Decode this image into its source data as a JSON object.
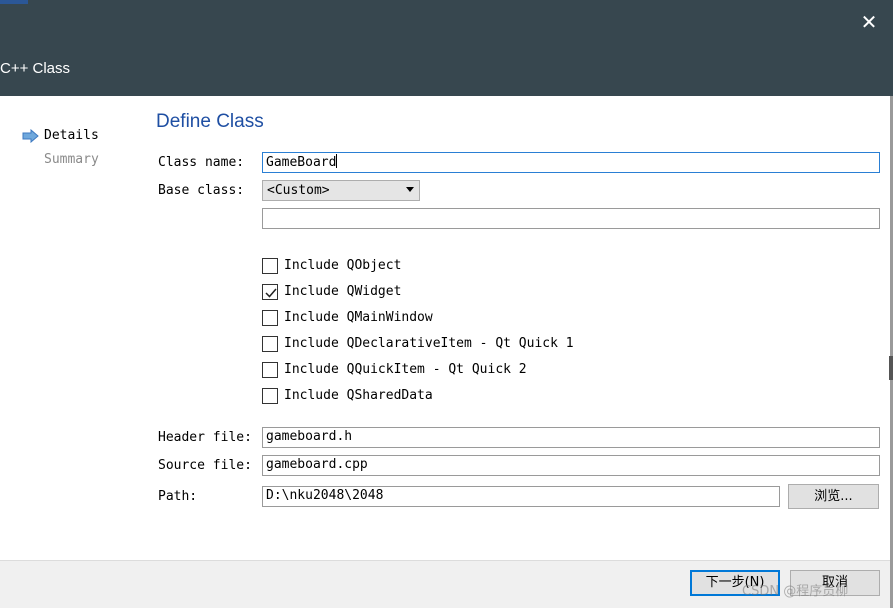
{
  "window": {
    "title": "C++ Class",
    "close_glyph": "✕",
    "titlebar_color": "#37474f"
  },
  "sidebar": {
    "steps": [
      {
        "label": "Details",
        "current": true
      },
      {
        "label": "Summary",
        "current": false
      }
    ],
    "current_step_icon": "arrow-right-icon"
  },
  "page": {
    "title": "Define Class",
    "title_color": "#1f4fa3"
  },
  "form": {
    "class_name_label": "Class name:",
    "class_name_value": "GameBoard",
    "base_class_label": "Base class:",
    "base_class_selected": "<Custom>",
    "custom_base_value": "",
    "includes": [
      {
        "label": "Include QObject",
        "checked": false
      },
      {
        "label": "Include QWidget",
        "checked": true
      },
      {
        "label": "Include QMainWindow",
        "checked": false
      },
      {
        "label": "Include QDeclarativeItem - Qt Quick 1",
        "checked": false
      },
      {
        "label": "Include QQuickItem - Qt Quick 2",
        "checked": false
      },
      {
        "label": "Include QSharedData",
        "checked": false
      }
    ],
    "header_file_label": "Header file:",
    "header_file_value": "gameboard.h",
    "source_file_label": "Source file:",
    "source_file_value": "gameboard.cpp",
    "path_label": "Path:",
    "path_value": "D:\\nku2048\\2048",
    "browse_label": "浏览..."
  },
  "footer": {
    "next_label": "下一步(N)",
    "cancel_label": "取消"
  },
  "watermark": "CSDN @程序员柳"
}
